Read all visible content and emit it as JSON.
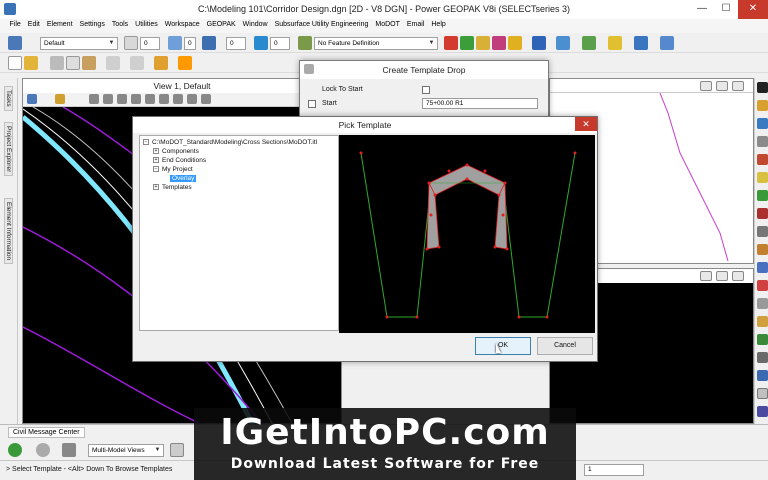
{
  "window": {
    "title": "C:\\Modeling 101\\Corridor Design.dgn [2D - V8 DGN] - Power GEOPAK V8i (SELECTseries 3)",
    "minimize": "—",
    "maximize": "☐",
    "close": "✕"
  },
  "menu": {
    "items": [
      "File",
      "Edit",
      "Element",
      "Settings",
      "Tools",
      "Utilities",
      "Workspace",
      "GEOPAK",
      "Window",
      "Subsurface Utility Engineering",
      "MoDOT",
      "Email",
      "Help"
    ]
  },
  "toolbar": {
    "level_combo": "Default",
    "color_value": "0",
    "weight_value": "0",
    "style_value": "0",
    "line_value": "0",
    "feature_combo": "No Feature Definition"
  },
  "side_tabs": [
    "Tasks",
    "Project Explorer",
    "Element Information"
  ],
  "view1": {
    "title": "View 1, Default"
  },
  "create_template_drop": {
    "title": "Create Template Drop",
    "lock_to_start_label": "Lock To Start",
    "start_label": "Start",
    "start_value": "75+00.00 R1"
  },
  "pick_template": {
    "title": "Pick Template",
    "close": "✕",
    "tree": {
      "root": "C:\\MoDOT_Standard\\Modeling\\Cross Sections\\MoDOT.itl",
      "components": "Components",
      "end_conditions": "End Conditions",
      "my_project": "My Project",
      "overlay": "Overlay",
      "templates": "Templates"
    },
    "ok_label": "OK",
    "cancel_label": "Cancel"
  },
  "watermark": {
    "title": "IGetIntoPC.com",
    "subtitle": "Download Latest Software for Free"
  },
  "message_center": {
    "tab_label": "Civil Message Center"
  },
  "bottom_toolbar": {
    "model_views": "Multi-Model Views"
  },
  "status": {
    "text": "> Select Template - <Alt> Down To Browse Templates",
    "coord1": "1"
  },
  "colors": {
    "accent": "#3399ff",
    "close_red": "#c7392b",
    "preview_green": "#2eaa2e",
    "preview_red": "#e02020",
    "road_cyan": "#7fe8ff",
    "road_purple": "#9b1bd6"
  }
}
